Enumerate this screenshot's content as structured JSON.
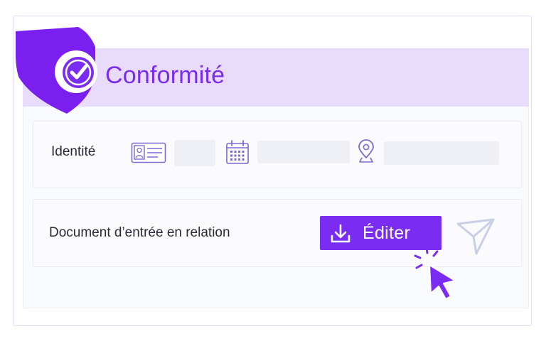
{
  "card": {
    "title": "Conformité",
    "icons": {
      "badge": "shield-check-icon"
    }
  },
  "identity_section": {
    "label": "Identité",
    "icons": [
      "id-card-icon",
      "calendar-icon",
      "location-icon"
    ]
  },
  "document_section": {
    "label": "Document d’entrée en relation",
    "edit_button": {
      "label": "Éditer",
      "icon": "download-icon"
    },
    "send_icon": "send-icon"
  },
  "colors": {
    "accent": "#7a2cf2",
    "header_background": "#e8dbfc",
    "shield": "#7a1ff0",
    "icon_outline": "#7a6ad8"
  }
}
